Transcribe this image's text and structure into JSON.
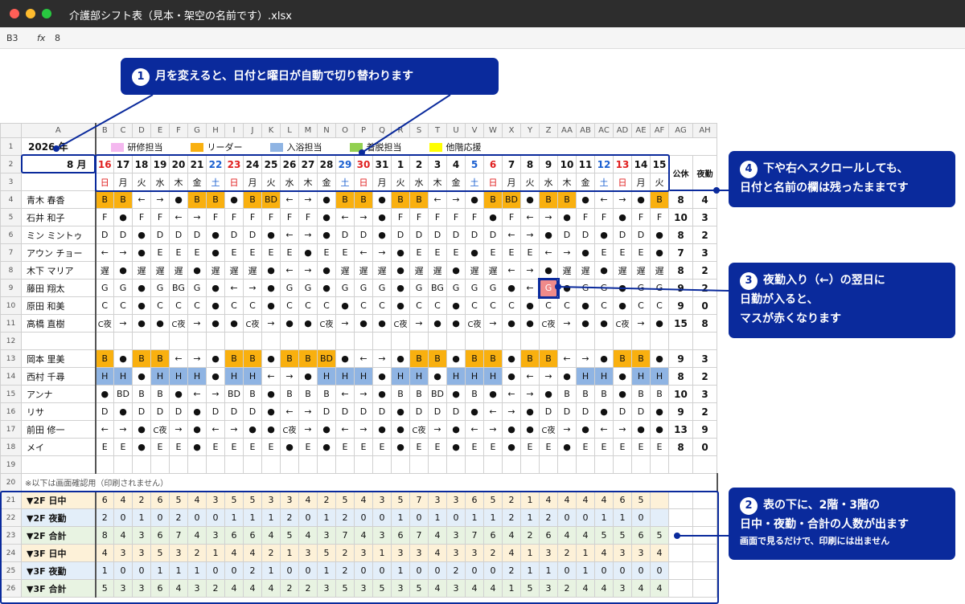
{
  "window": {
    "title": "介護部シフト表（見本・架空の名前です）.xlsx"
  },
  "formula": {
    "cell": "B3",
    "fx": "fx",
    "value": "8"
  },
  "cols": [
    "A",
    "B",
    "C",
    "D",
    "E",
    "F",
    "G",
    "H",
    "I",
    "J",
    "K",
    "L",
    "M",
    "N",
    "O",
    "P",
    "Q",
    "R",
    "S",
    "T",
    "U",
    "V",
    "W",
    "X",
    "Y",
    "Z",
    "AA",
    "AB",
    "AC",
    "AD",
    "AE",
    "AF",
    "AG",
    "AH"
  ],
  "year": "2026 年",
  "month": "8 月",
  "legend": [
    {
      "label": "研修担当",
      "color": "#f4b8ef"
    },
    {
      "label": "リーダー",
      "color": "#f9b00f"
    },
    {
      "label": "入浴担当",
      "color": "#8fb4e3"
    },
    {
      "label": "着脱担当",
      "color": "#92d050"
    },
    {
      "label": "他階応援",
      "color": "#ffff00"
    }
  ],
  "dates": [
    "16",
    "17",
    "18",
    "19",
    "20",
    "21",
    "22",
    "23",
    "24",
    "25",
    "26",
    "27",
    "28",
    "29",
    "30",
    "31",
    "1",
    "2",
    "3",
    "4",
    "5",
    "6",
    "7",
    "8",
    "9",
    "10",
    "11",
    "12",
    "13",
    "14",
    "15"
  ],
  "weekdays": [
    "日",
    "月",
    "火",
    "水",
    "木",
    "金",
    "土",
    "日",
    "月",
    "火",
    "水",
    "木",
    "金",
    "土",
    "日",
    "月",
    "火",
    "水",
    "木",
    "金",
    "土",
    "日",
    "月",
    "火",
    "水",
    "木",
    "金",
    "土",
    "日",
    "月",
    "火"
  ],
  "day_colors": {
    "sunday": "#e02020",
    "saturday": "#1a5fd0",
    "holiday_note": "23 and 30 and 13 in red"
  },
  "holiday_header": "公休",
  "night_header": "夜勤",
  "staff": [
    {
      "row": "4",
      "name": "青木 春香",
      "shifts": "B,B,←,→,●,B,B,●,B,BD,←,→,●,B,B,●,B,B,←,→,●,B,BD,●,B,B,●,←,→,●,B",
      "hol": "8",
      "night": "4",
      "fill": "l:0,1,5,6,8,9,13,14,16,17,21,22,24,25,30"
    },
    {
      "row": "5",
      "name": "石井 和子",
      "shifts": "F,●,F,F,←,→,F,F,F,F,F,F,●,←,→,●,F,F,F,F,F,●,F,←,→,●,F,F,●,F,F",
      "hol": "10",
      "night": "3",
      "fill": ""
    },
    {
      "row": "6",
      "name": "ミン ミントゥ",
      "shifts": "D,D,●,D,D,D,●,D,D,●,←,→,●,D,D,●,D,D,D,D,D,D,←,→,●,D,D,●,D,D,●",
      "hol": "8",
      "night": "2",
      "fill": ""
    },
    {
      "row": "7",
      "name": "アウン チョー",
      "shifts": "←,→,●,E,E,E,●,E,E,E,E,●,E,E,←,→,●,E,E,E,●,E,E,E,←,→,●,E,E,E,●",
      "hol": "7",
      "night": "3",
      "fill": ""
    },
    {
      "row": "8",
      "name": "木下 マリア",
      "shifts": "遅,●,遅,遅,遅,●,遅,遅,遅,●,←,→,●,遅,遅,遅,●,遅,遅,●,遅,遅,←,→,●,遅,遅,●,遅,遅,遅",
      "hol": "8",
      "night": "2",
      "fill": ""
    },
    {
      "row": "9",
      "name": "藤田 翔太",
      "shifts": "G,G,●,G,BG,G,●,←,→,●,G,G,●,G,G,G,●,G,BG,G,G,G,●,←,G,●,G,G,●,G,G",
      "hol": "9",
      "night": "2",
      "fill": "r:24"
    },
    {
      "row": "10",
      "name": "原田 和美",
      "shifts": "C,C,●,C,C,C,●,C,C,●,C,C,C,●,C,C,●,C,C,●,C,C,C,●,C,C,●,C,●,C,C",
      "hol": "9",
      "night": "0",
      "fill": ""
    },
    {
      "row": "11",
      "name": "高橋 直樹",
      "shifts": "C夜,→,●,●,C夜,→,●,●,C夜,→,●,●,C夜,→,●,●,C夜,→,●,●,C夜,→,●,●,C夜,→,●,●,C夜,→,●",
      "hol": "15",
      "night": "8",
      "fill": ""
    },
    {
      "row": "12",
      "name": "",
      "shifts": ",,,,,,,,,,,,,,,,,,,,,,,,,,,,,,",
      "hol": "",
      "night": "",
      "fill": ""
    },
    {
      "row": "13",
      "name": "岡本 里美",
      "shifts": "B,●,B,B,←,→,●,B,B,●,B,B,BD,●,←,→,●,B,B,●,B,B,●,B,B,←,→,●,B,B,●",
      "hol": "9",
      "night": "3",
      "fill": "l:0,2,3,7,8,10,11,12,17,18,20,21,23,24,28,29"
    },
    {
      "row": "14",
      "name": "西村 千尋",
      "shifts": "H,H,●,H,H,H,●,H,H,←,→,●,H,H,H,●,H,H,●,H,H,H,●,←,→,●,H,H,●,H,H",
      "hol": "8",
      "night": "2",
      "fill": "b:0,1,3,4,5,7,8,12,13,14,16,17,19,20,21,26,27,29,30"
    },
    {
      "row": "15",
      "name": "アンナ",
      "shifts": "●,BD,B,B,●,←,→,BD,B,●,B,B,B,←,→,●,B,B,BD,●,B,●,←,→,●,B,B,B,●,B,B",
      "hol": "10",
      "night": "3",
      "fill": ""
    },
    {
      "row": "16",
      "name": "リサ",
      "shifts": "D,●,D,D,D,●,D,D,D,●,←,→,D,D,D,D,●,D,D,D,●,←,→,●,D,D,D,●,D,D,●",
      "hol": "9",
      "night": "2",
      "fill": ""
    },
    {
      "row": "17",
      "name": "前田 修一",
      "shifts": "←,→,●,C夜,→,●,←,→,●,●,C夜,→,●,←,→,●,●,C夜,→,●,←,→,●,●,C夜,→,●,←,→,●,●",
      "hol": "13",
      "night": "9",
      "fill": ""
    },
    {
      "row": "18",
      "name": "メイ",
      "shifts": "E,E,●,E,E,●,E,E,E,E,●,E,●,E,E,E,●,E,E,●,E,E,●,E,E,●,E,E,E,E,E",
      "hol": "8",
      "night": "0",
      "fill": ""
    }
  ],
  "row19": "19",
  "row20": {
    "num": "20",
    "note": "※以下は画面確認用（印刷されません）"
  },
  "summary": [
    {
      "row": "21",
      "label": "▼2F 日中",
      "vals": "6,4,2,6,5,4,3,5,5,3,3,4,2,5,4,3,5,7,3,3,6,5,2,1,4,4,4,4,6,5",
      "bg": "#fdf1d8"
    },
    {
      "row": "22",
      "label": "▼2F 夜勤",
      "vals": "2,0,1,0,2,0,0,1,1,1,2,0,1,2,0,0,1,0,1,0,1,1,2,1,2,0,0,1,1,0",
      "bg": "#e3eef9"
    },
    {
      "row": "23",
      "label": "▼2F 合計",
      "vals": "8,4,3,6,7,4,3,6,6,4,5,4,3,7,4,3,6,7,4,3,7,6,4,2,6,4,4,5,5,6,5",
      "bg": "#e8f3e2"
    },
    {
      "row": "24",
      "label": "▼3F 日中",
      "vals": "4,3,3,5,3,2,1,4,4,2,1,3,5,2,3,1,3,3,4,3,3,2,4,1,3,2,1,4,3,3,4",
      "bg": "#fdf1d8"
    },
    {
      "row": "25",
      "label": "▼3F 夜勤",
      "vals": "1,0,0,1,1,1,0,0,2,1,0,0,1,2,0,0,1,0,0,2,0,0,2,1,1,0,1,0,0,0,0",
      "bg": "#e3eef9"
    },
    {
      "row": "26",
      "label": "▼3F 合計",
      "vals": "5,3,3,6,4,3,2,4,4,4,2,2,3,5,3,5,3,5,4,3,4,4,1,5,3,2,4,4,3,4,4",
      "bg": "#e8f3e2"
    }
  ],
  "callouts": {
    "c1": {
      "num": "1",
      "text": "月を変えると、日付と曜日が自動で切り替わります"
    },
    "c2": {
      "num": "2",
      "line1": "表の下に、2階・3階の",
      "line2": "日中・夜勤・合計の人数が出ます",
      "line3": "画面で見るだけで、印刷には出ません"
    },
    "c3": {
      "num": "3",
      "line1": "夜勤入り（←）の翌日に",
      "line2": "日勤が入ると、",
      "line3": "マスが赤くなります"
    },
    "c4": {
      "num": "4",
      "line1": "下や右へスクロールしても、",
      "line2": "日付と名前の欄は残ったままです"
    }
  }
}
